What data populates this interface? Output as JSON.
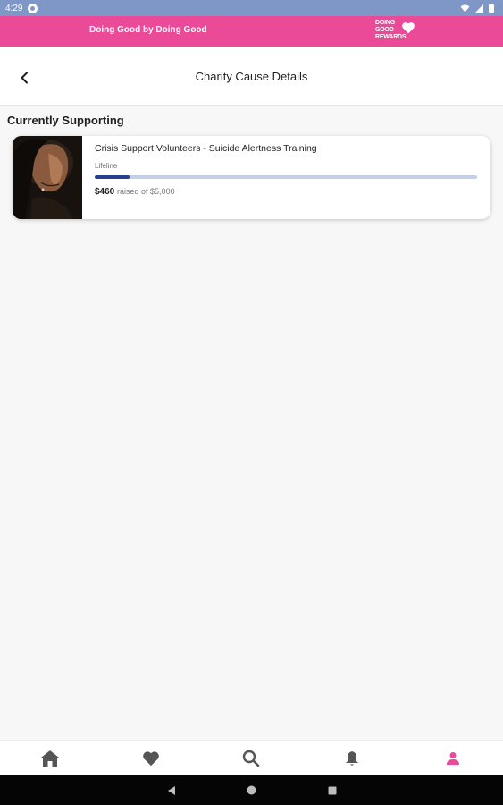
{
  "status_bar": {
    "time": "4:29"
  },
  "brand_banner": {
    "tagline": "Doing Good by Doing Good",
    "logo_lines": [
      "DOING",
      "GOOD",
      "REWARDS"
    ]
  },
  "header": {
    "title": "Charity Cause Details"
  },
  "section": {
    "title": "Currently Supporting"
  },
  "cause": {
    "title": "Crisis Support Volunteers  - Suicide Alertness Training",
    "organization": "Lifeline",
    "raised": "$460",
    "raised_suffix": "raised of $5,000",
    "progress_fraction": 0.092
  },
  "bottom_nav": {
    "items": [
      "home-icon",
      "heart-icon",
      "search-icon",
      "bell-icon",
      "profile-icon"
    ],
    "active": "profile-icon"
  },
  "colors": {
    "brand_pink": "#ea4a97",
    "status_bar": "#7f97c7",
    "progress_fill": "#263f8f",
    "progress_track": "#c5cfe3",
    "nav_inactive": "#555555",
    "nav_active": "#ea4a97"
  }
}
